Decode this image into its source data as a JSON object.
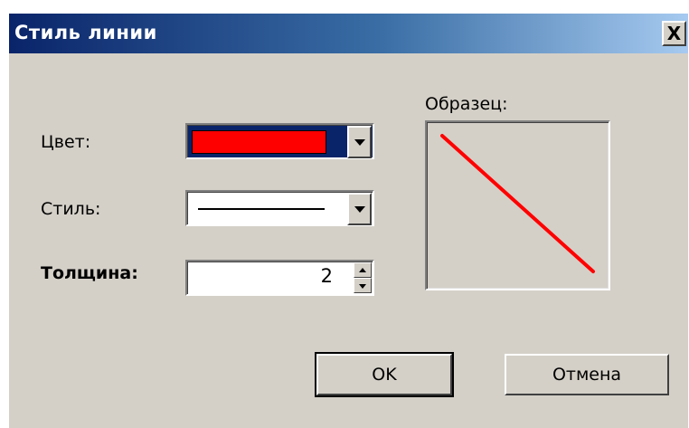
{
  "window": {
    "title": "Стиль линии",
    "close_label": "X"
  },
  "fields": {
    "color_label": "Цвет:",
    "color_value": "#ff0000",
    "style_label": "Стиль:",
    "style_value": "solid",
    "thickness_label": "Толщина:",
    "thickness_value": "2"
  },
  "sample": {
    "label": "Образец:",
    "line_color": "#ff0000"
  },
  "buttons": {
    "ok_label": "OK",
    "cancel_label": "Отмена"
  }
}
